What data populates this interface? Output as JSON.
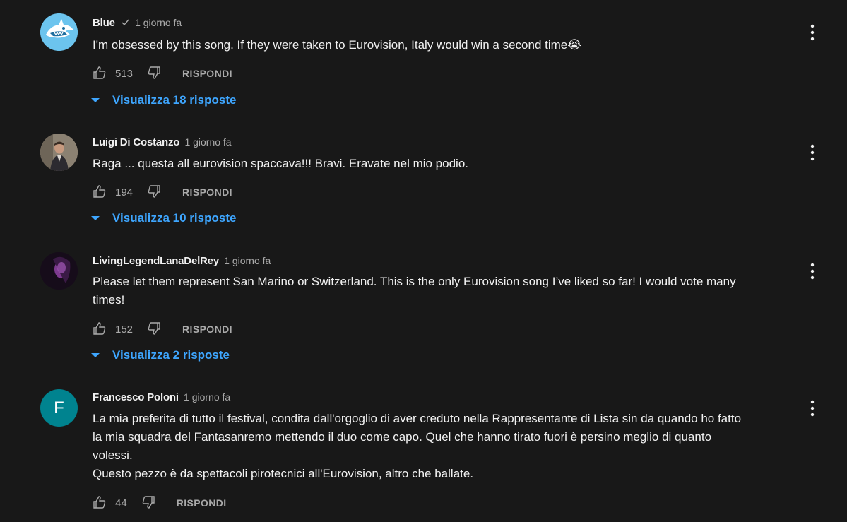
{
  "comments": [
    {
      "author": "Blue",
      "verified": true,
      "time": "1 giorno fa",
      "text": "I'm obsessed by this song. If they were taken to Eurovision, Italy would win a second time😭",
      "likes": "513",
      "reply_label": "RISPONDI",
      "replies_label": "Visualizza 18 risposte"
    },
    {
      "author": "Luigi Di Costanzo",
      "verified": false,
      "time": "1 giorno fa",
      "text": "Raga ... questa all eurovision spaccava!!! Bravi. Eravate nel mio podio.",
      "likes": "194",
      "reply_label": "RISPONDI",
      "replies_label": "Visualizza 10 risposte"
    },
    {
      "author": "LivingLegendLanaDelRey",
      "verified": false,
      "time": "1 giorno fa",
      "text": "Please let them represent San Marino or Switzerland. This is the only Eurovision song I’ve liked so far! I would vote many\ntimes!",
      "likes": "152",
      "reply_label": "RISPONDI",
      "replies_label": "Visualizza 2 risposte"
    },
    {
      "author": "Francesco Poloni",
      "verified": false,
      "time": "1 giorno fa",
      "avatar_letter": "F",
      "avatar_color": "#00838f",
      "text": "La mia preferita di tutto il festival, condita dall'orgoglio di aver creduto nella Rappresentante di Lista sin da quando ho fatto\nla mia squadra del Fantasanremo mettendo il duo come capo. Quel che hanno tirato fuori è persino meglio di quanto\nvolessi.\nQuesto pezzo è da spettacoli pirotecnici all'Eurovision, altro che ballate.",
      "likes": "44",
      "reply_label": "RISPONDI"
    }
  ],
  "colors": {
    "background": "#181818",
    "link": "#3ea6ff",
    "secondary_text": "#aaaaaa"
  }
}
